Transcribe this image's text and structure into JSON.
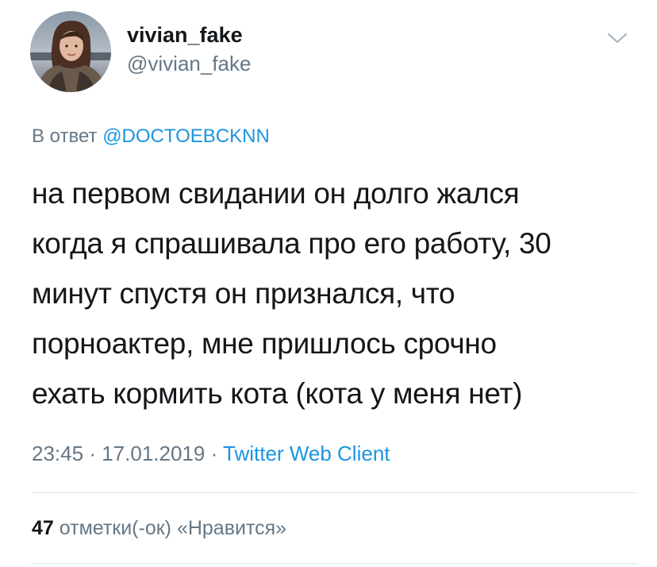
{
  "user": {
    "display_name": "vivian_fake",
    "handle": "@vivian_fake"
  },
  "reply": {
    "prefix": "В ответ",
    "mention": "@DOCTOEBCKNN"
  },
  "tweet": {
    "lines": [
      "на первом свидании он долго жался",
      "когда я спрашивала про его работу, 30",
      "минут спустя он признался, что",
      "порноактер, мне пришлось срочно",
      "ехать кормить кота (кота у меня нет)"
    ]
  },
  "meta": {
    "time": "23:45",
    "separator": "·",
    "date": "17.01.2019",
    "client": "Twitter Web Client"
  },
  "likes": {
    "count": "47",
    "label": "отметки(-ок) «Нравится»"
  },
  "icons": {
    "menu": "chevron-down-icon"
  },
  "colors": {
    "link": "#1b95e0",
    "secondary_text": "#657786",
    "primary_text": "#14171a",
    "divider": "#e1e8ed"
  }
}
